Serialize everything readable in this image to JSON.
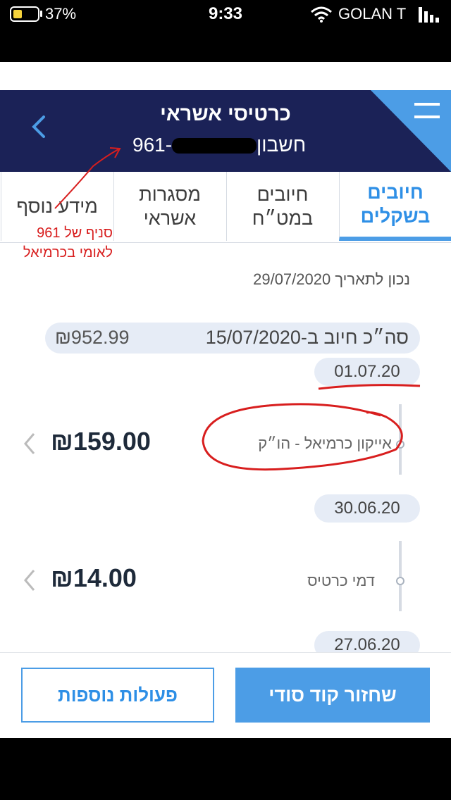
{
  "status_bar": {
    "battery_percent": "37%",
    "time": "9:33",
    "carrier": "GOLAN T"
  },
  "header": {
    "title": "כרטיסי אשראי",
    "account_label": "חשבון",
    "account_prefix": "961-",
    "colors": {
      "background": "#1b2257",
      "accent": "#4c9de6"
    }
  },
  "tabs": [
    {
      "label": "חיובים\nבשקלים",
      "active": true
    },
    {
      "label": "חיובים\nבמט״ח",
      "active": false
    },
    {
      "label": "מסגרות\nאשראי",
      "active": false
    },
    {
      "label": "מידע נוסף",
      "active": false
    }
  ],
  "as_of_date": "נכון לתאריך 29/07/2020",
  "total": {
    "label": "סה״כ חיוב ב-15/07/2020",
    "amount": "₪952.99"
  },
  "timeline": [
    {
      "date": "01.07.20",
      "description": "אייקון כרמיאל - הו״ק",
      "amount": "₪159.00"
    },
    {
      "date": "30.06.20",
      "description": "דמי כרטיס",
      "amount": "₪14.00"
    },
    {
      "date": "27.06.20"
    }
  ],
  "buttons": {
    "reset_code": "שחזור קוד סודי",
    "more_actions": "פעולות נוספות"
  },
  "annotation": {
    "line1": "961 סניף של",
    "line2": "לאומי בכרמיאל"
  }
}
